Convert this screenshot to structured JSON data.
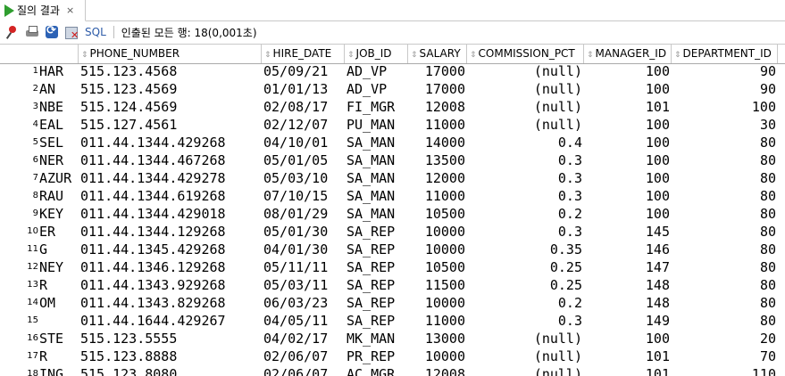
{
  "tab": {
    "title": "질의 결과",
    "close": "×"
  },
  "toolbar": {
    "icons": [
      "pin-icon",
      "print-icon",
      "refresh-icon",
      "clear-icon"
    ],
    "sql_label": "SQL",
    "status": "인출된 모든 행: 18(0,001초)"
  },
  "columns": [
    "PHONE_NUMBER",
    "HIRE_DATE",
    "JOB_ID",
    "SALARY",
    "COMMISSION_PCT",
    "MANAGER_ID",
    "DEPARTMENT_ID"
  ],
  "rows": [
    {
      "n": "1",
      "frag": "HAR",
      "phone": "515.123.4568",
      "hire": "05/09/21",
      "job": "AD_VP",
      "salary": "17000",
      "comm": "(null)",
      "mgr": "100",
      "dept": "90"
    },
    {
      "n": "2",
      "frag": "AN",
      "phone": "515.123.4569",
      "hire": "01/01/13",
      "job": "AD_VP",
      "salary": "17000",
      "comm": "(null)",
      "mgr": "100",
      "dept": "90"
    },
    {
      "n": "3",
      "frag": "NBE",
      "phone": "515.124.4569",
      "hire": "02/08/17",
      "job": "FI_MGR",
      "salary": "12008",
      "comm": "(null)",
      "mgr": "101",
      "dept": "100"
    },
    {
      "n": "4",
      "frag": "EAL",
      "phone": "515.127.4561",
      "hire": "02/12/07",
      "job": "PU_MAN",
      "salary": "11000",
      "comm": "(null)",
      "mgr": "100",
      "dept": "30"
    },
    {
      "n": "5",
      "frag": "SEL",
      "phone": "011.44.1344.429268",
      "hire": "04/10/01",
      "job": "SA_MAN",
      "salary": "14000",
      "comm": "0.4",
      "mgr": "100",
      "dept": "80"
    },
    {
      "n": "6",
      "frag": "NER",
      "phone": "011.44.1344.467268",
      "hire": "05/01/05",
      "job": "SA_MAN",
      "salary": "13500",
      "comm": "0.3",
      "mgr": "100",
      "dept": "80"
    },
    {
      "n": "7",
      "frag": "AZUR",
      "phone": "011.44.1344.429278",
      "hire": "05/03/10",
      "job": "SA_MAN",
      "salary": "12000",
      "comm": "0.3",
      "mgr": "100",
      "dept": "80"
    },
    {
      "n": "8",
      "frag": "RAU",
      "phone": "011.44.1344.619268",
      "hire": "07/10/15",
      "job": "SA_MAN",
      "salary": "11000",
      "comm": "0.3",
      "mgr": "100",
      "dept": "80"
    },
    {
      "n": "9",
      "frag": "KEY",
      "phone": "011.44.1344.429018",
      "hire": "08/01/29",
      "job": "SA_MAN",
      "salary": "10500",
      "comm": "0.2",
      "mgr": "100",
      "dept": "80"
    },
    {
      "n": "10",
      "frag": "ER",
      "phone": "011.44.1344.129268",
      "hire": "05/01/30",
      "job": "SA_REP",
      "salary": "10000",
      "comm": "0.3",
      "mgr": "145",
      "dept": "80"
    },
    {
      "n": "11",
      "frag": "G",
      "phone": "011.44.1345.429268",
      "hire": "04/01/30",
      "job": "SA_REP",
      "salary": "10000",
      "comm": "0.35",
      "mgr": "146",
      "dept": "80"
    },
    {
      "n": "12",
      "frag": "NEY",
      "phone": "011.44.1346.129268",
      "hire": "05/11/11",
      "job": "SA_REP",
      "salary": "10500",
      "comm": "0.25",
      "mgr": "147",
      "dept": "80"
    },
    {
      "n": "13",
      "frag": "R",
      "phone": "011.44.1343.929268",
      "hire": "05/03/11",
      "job": "SA_REP",
      "salary": "11500",
      "comm": "0.25",
      "mgr": "148",
      "dept": "80"
    },
    {
      "n": "14",
      "frag": "OM",
      "phone": "011.44.1343.829268",
      "hire": "06/03/23",
      "job": "SA_REP",
      "salary": "10000",
      "comm": "0.2",
      "mgr": "148",
      "dept": "80"
    },
    {
      "n": "15",
      "frag": "",
      "phone": "011.44.1644.429267",
      "hire": "04/05/11",
      "job": "SA_REP",
      "salary": "11000",
      "comm": "0.3",
      "mgr": "149",
      "dept": "80"
    },
    {
      "n": "16",
      "frag": "STE",
      "phone": "515.123.5555",
      "hire": "04/02/17",
      "job": "MK_MAN",
      "salary": "13000",
      "comm": "(null)",
      "mgr": "100",
      "dept": "20"
    },
    {
      "n": "17",
      "frag": "R",
      "phone": "515.123.8888",
      "hire": "02/06/07",
      "job": "PR_REP",
      "salary": "10000",
      "comm": "(null)",
      "mgr": "101",
      "dept": "70"
    },
    {
      "n": "18",
      "frag": "ING",
      "phone": "515.123.8080",
      "hire": "02/06/07",
      "job": "AC_MGR",
      "salary": "12008",
      "comm": "(null)",
      "mgr": "101",
      "dept": "110"
    }
  ]
}
